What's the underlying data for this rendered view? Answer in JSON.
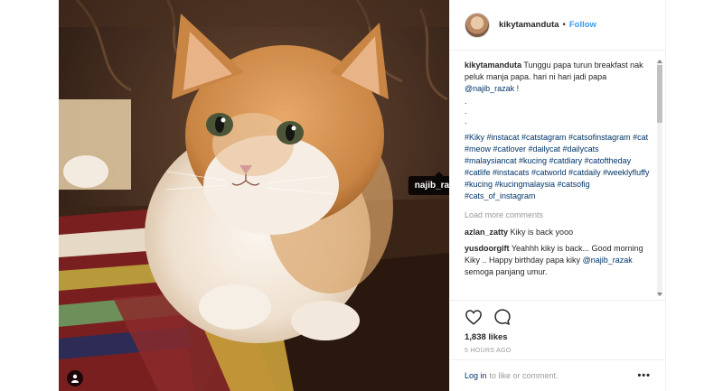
{
  "post": {
    "image_alt": "Fluffy orange and white cat sitting on a striped cushion",
    "tag_label": "najib_razak"
  },
  "header": {
    "username": "kikytamanduta",
    "separator": "•",
    "follow_label": "Follow"
  },
  "caption": {
    "username": "kikytamanduta",
    "text_before": "Tunggu papa turun breakfast nak peluk manja papa. hari ni hari jadi papa ",
    "mention": "@najib_razak",
    "text_after": " !",
    "dots": [
      ".",
      ".",
      "."
    ],
    "hashtags": "#Kiky #instacat #catstagram #catsofinstagram #cat #meow #catlover #dailycat #dailycats #malaysiancat #kucing #catdiary #catoftheday #catlife #instacats #catworld #catdaily #weeklyfluffy #kucing #kucingmalaysia #catsofig #cats_of_instagram"
  },
  "load_more_label": "Load more comments",
  "comments": [
    {
      "user": "azlan_zatty",
      "text": "Kiky is back yooo"
    },
    {
      "user": "yusdoorgift",
      "text_before": "Yeahhh kiky is back... Good morning Kiky .. Happy birthday papa kiky ",
      "mention": "@najib_razak",
      "text_after": " semoga panjang umur."
    }
  ],
  "actions": {
    "like_icon": "heart-icon",
    "comment_icon": "comment-icon",
    "likes_text": "1,838 likes",
    "timestamp": "5 HOURS AGO"
  },
  "footer": {
    "login_link": "Log in",
    "login_rest": "to like or comment.",
    "more_label": "•••"
  },
  "colors": {
    "link_blue": "#3897f0",
    "hashtag_navy": "#003569",
    "muted": "#999999"
  }
}
